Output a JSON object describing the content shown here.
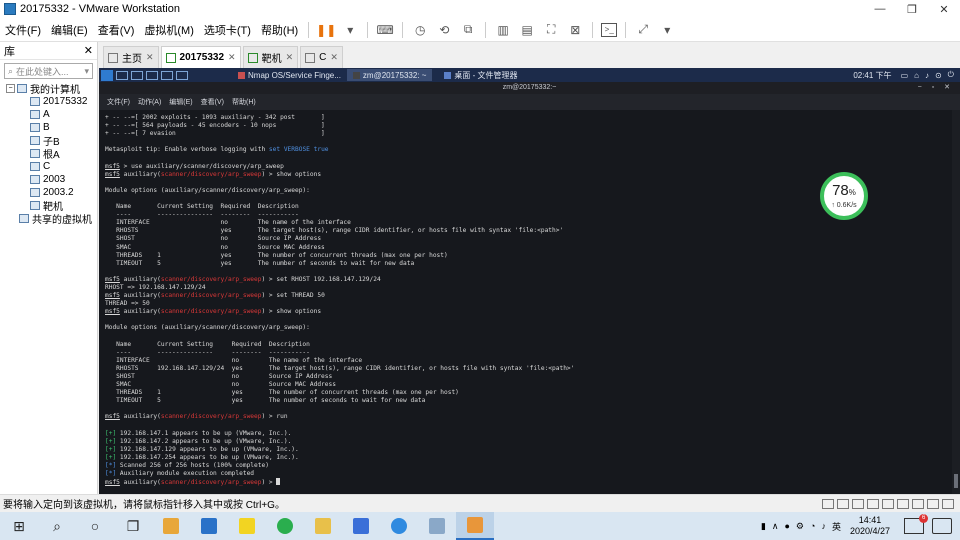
{
  "window": {
    "title": "20175332 - VMware Workstation",
    "controls": [
      "—",
      "❐",
      "✕"
    ]
  },
  "menu": [
    "文件(F)",
    "编辑(E)",
    "查看(V)",
    "虚拟机(M)",
    "选项卡(T)",
    "帮助(H)"
  ],
  "library": {
    "title": "库",
    "close": "✕",
    "search_placeholder": "在此处键入...",
    "root": "我的计算机",
    "vms": [
      "20175332",
      "A",
      "B",
      "子B",
      "根A",
      "C",
      "2003",
      "2003.2",
      "靶机"
    ],
    "shared": "共享的虚拟机"
  },
  "tabs": [
    {
      "label": "主页",
      "active": false
    },
    {
      "label": "20175332",
      "active": true
    },
    {
      "label": "靶机",
      "active": false
    },
    {
      "label": "C",
      "active": false
    }
  ],
  "guest_panel": {
    "windows": [
      "Nmap OS/Service Finge...",
      "zm@20175332: ~",
      "桌面 - 文件管理器"
    ],
    "clock": "02:41 下午"
  },
  "terminal": {
    "title": "zm@20175332:~",
    "menu": [
      "文件(F)",
      "动作(A)",
      "编辑(E)",
      "查看(V)",
      "帮助(H)"
    ],
    "lines": [
      {
        "t": "+ -- --=[ 2002 exploits - 1093 auxiliary - 342 post       ]"
      },
      {
        "t": "+ -- --=[ 564 payloads - 45 encoders - 10 nops            ]"
      },
      {
        "t": "+ -- --=[ 7 evasion                                       ]"
      },
      {
        "t": ""
      },
      {
        "t": "Metasploit tip: Enable verbose logging with ",
        "tail": "set VERBOSE true",
        "tailcls": "blu"
      },
      {
        "t": ""
      },
      {
        "prompt": true,
        "cmd": "> use auxiliary/scanner/discovery/arp_sweep"
      },
      {
        "prompt": true,
        "mod": "scanner/discovery/arp_sweep",
        "cmd": ") > show options"
      },
      {
        "t": ""
      },
      {
        "t": "Module options (auxiliary/scanner/discovery/arp_sweep):"
      },
      {
        "t": ""
      },
      {
        "t": "   Name       Current Setting  Required  Description"
      },
      {
        "t": "   ----       ---------------  --------  -----------"
      },
      {
        "t": "   INTERFACE                   no        The name of the interface"
      },
      {
        "t": "   RHOSTS                      yes       The target host(s), range CIDR identifier, or hosts file with syntax 'file:<path>'"
      },
      {
        "t": "   SHOST                       no        Source IP Address"
      },
      {
        "t": "   SMAC                        no        Source MAC Address"
      },
      {
        "t": "   THREADS    1                yes       The number of concurrent threads (max one per host)"
      },
      {
        "t": "   TIMEOUT    5                yes       The number of seconds to wait for new data"
      },
      {
        "t": ""
      },
      {
        "prompt": true,
        "mod": "scanner/discovery/arp_sweep",
        "cmd": ") > set RHOST 192.168.147.129/24"
      },
      {
        "t": "RHOST => 192.168.147.129/24"
      },
      {
        "prompt": true,
        "mod": "scanner/discovery/arp_sweep",
        "cmd": ") > set THREAD 50"
      },
      {
        "t": "THREAD => 50"
      },
      {
        "prompt": true,
        "mod": "scanner/discovery/arp_sweep",
        "cmd": ") > show options"
      },
      {
        "t": ""
      },
      {
        "t": "Module options (auxiliary/scanner/discovery/arp_sweep):"
      },
      {
        "t": ""
      },
      {
        "t": "   Name       Current Setting     Required  Description"
      },
      {
        "t": "   ----       ---------------     --------  -----------"
      },
      {
        "t": "   INTERFACE                      no        The name of the interface"
      },
      {
        "t": "   RHOSTS     192.168.147.129/24  yes       The target host(s), range CIDR identifier, or hosts file with syntax 'file:<path>'"
      },
      {
        "t": "   SHOST                          no        Source IP Address"
      },
      {
        "t": "   SMAC                           no        Source MAC Address"
      },
      {
        "t": "   THREADS    1                   yes       The number of concurrent threads (max one per host)"
      },
      {
        "t": "   TIMEOUT    5                   yes       The number of seconds to wait for new data"
      },
      {
        "t": ""
      },
      {
        "prompt": true,
        "mod": "scanner/discovery/arp_sweep",
        "cmd": ") > run"
      },
      {
        "t": ""
      },
      {
        "head": "[+]",
        "headcls": "grn",
        "t": " 192.168.147.1 appears to be up (VMware, Inc.)."
      },
      {
        "head": "[+]",
        "headcls": "grn",
        "t": " 192.168.147.2 appears to be up (VMware, Inc.)."
      },
      {
        "head": "[+]",
        "headcls": "grn",
        "t": " 192.168.147.129 appears to be up (VMware, Inc.)."
      },
      {
        "head": "[+]",
        "headcls": "grn",
        "t": " 192.168.147.254 appears to be up (VMware, Inc.)."
      },
      {
        "head": "[*]",
        "headcls": "blu",
        "t": " Scanned 256 of 256 hosts (100% complete)"
      },
      {
        "head": "[*]",
        "headcls": "blu",
        "t": " Auxiliary module execution completed"
      },
      {
        "prompt": true,
        "mod": "scanner/discovery/arp_sweep",
        "cmd": ") > ",
        "cursor": true
      }
    ],
    "prompt_label": "msf5",
    "prompt_aux": " auxiliary(",
    "prompt_sep": " "
  },
  "net_widget": {
    "percent": "78",
    "percent_unit": "%",
    "speed": "↑ 0.6K/s"
  },
  "statusbar": {
    "text": "要将输入定向到该虚拟机，请将鼠标指针移入其中或按 Ctrl+G。"
  },
  "taskbar": {
    "tray_text": [
      "∧",
      "英"
    ],
    "time": "14:41",
    "date": "2020/4/27",
    "notif_count": "6"
  }
}
